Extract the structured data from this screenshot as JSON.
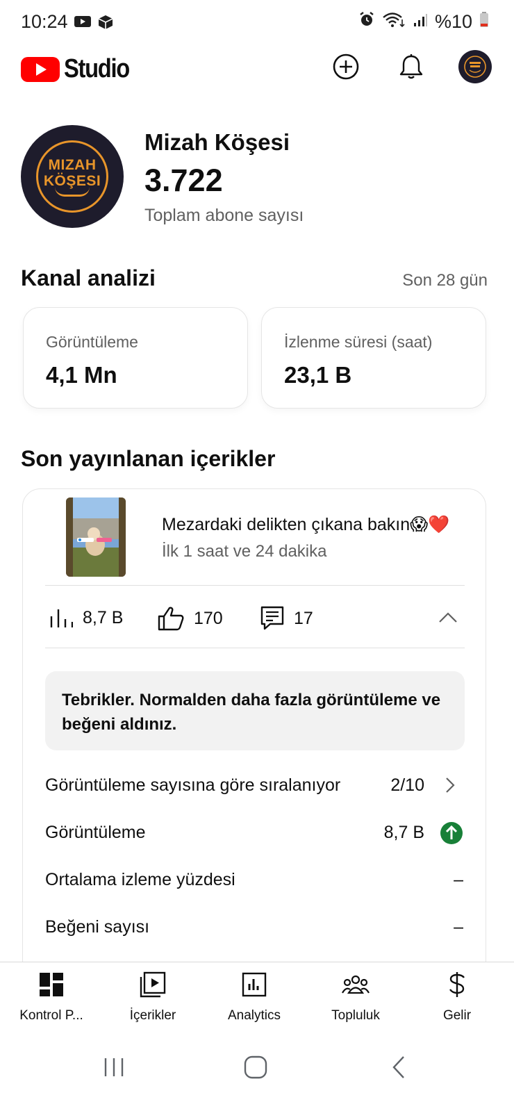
{
  "status_bar": {
    "time": "10:24",
    "battery": "%10"
  },
  "header": {
    "logo_text": "Studio",
    "accent_color": "#ff0000"
  },
  "channel": {
    "name": "Mizah Köşesi",
    "subscriber_count": "3.722",
    "subscriber_label": "Toplam abone sayısı",
    "avatar_text": [
      "MIZAH",
      "KÖŞESI"
    ],
    "avatar_brand_color": "#e8952a"
  },
  "analytics": {
    "title": "Kanal analizi",
    "range": "Son 28 gün",
    "cards": [
      {
        "label": "Görüntüleme",
        "value": "4,1 Mn"
      },
      {
        "label": "İzlenme süresi (saat)",
        "value": "23,1 B"
      }
    ]
  },
  "recent": {
    "title": "Son yayınlanan içerikler",
    "video": {
      "title": "Mezardaki delikten çıkana bakın😱❤️",
      "subtitle": "İlk 1 saat ve 24 dakika",
      "views": "8,7 B",
      "likes": "170",
      "comments": "17"
    },
    "message": "Tebrikler. Normalden daha fazla görüntüleme ve beğeni aldınız.",
    "rows": [
      {
        "label": "Görüntüleme sayısına göre sıralanıyor",
        "value": "2/10"
      },
      {
        "label": "Görüntüleme",
        "value": "8,7 B"
      },
      {
        "label": "Ortalama izleme yüzdesi",
        "value": "–"
      },
      {
        "label": "Beğeni sayısı",
        "value": "–"
      }
    ],
    "up_indicator_color": "#188038"
  },
  "bottom_nav": {
    "items": [
      {
        "label": "Kontrol P...",
        "icon": "dashboard-icon"
      },
      {
        "label": "İçerikler",
        "icon": "content-icon"
      },
      {
        "label": "Analytics",
        "icon": "analytics-icon"
      },
      {
        "label": "Topluluk",
        "icon": "community-icon"
      },
      {
        "label": "Gelir",
        "icon": "dollar-icon"
      }
    ]
  }
}
